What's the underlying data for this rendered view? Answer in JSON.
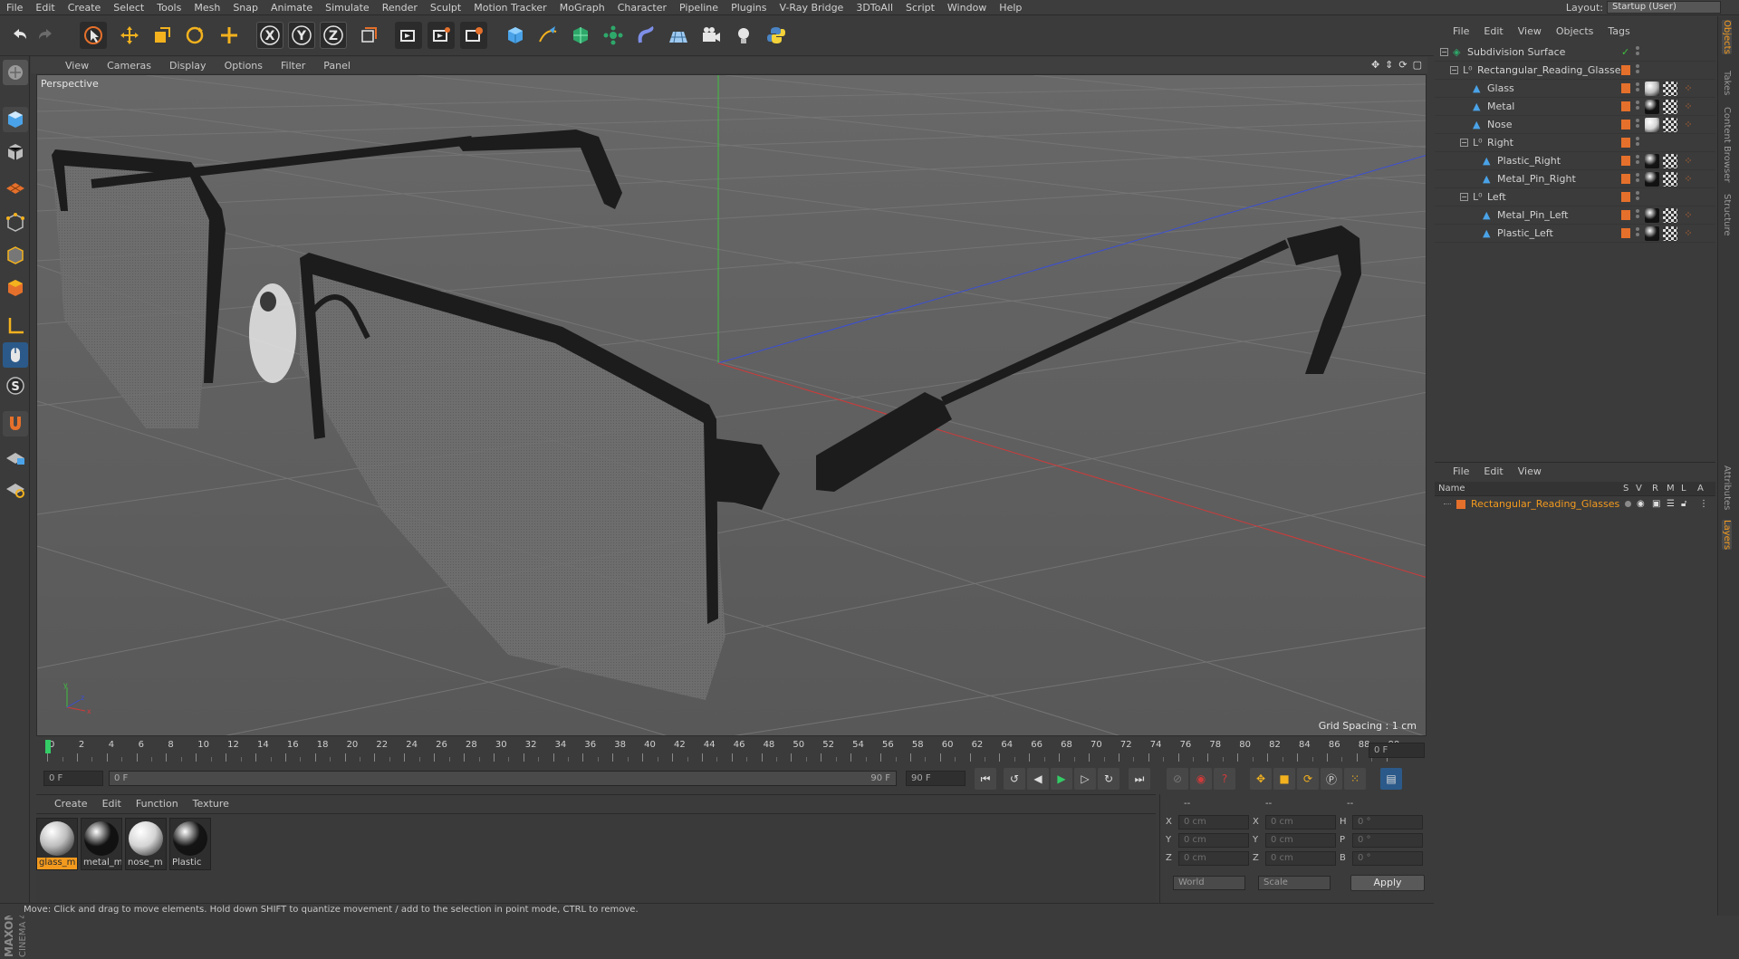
{
  "menubar": {
    "items": [
      "File",
      "Edit",
      "Create",
      "Select",
      "Tools",
      "Mesh",
      "Snap",
      "Animate",
      "Simulate",
      "Render",
      "Sculpt",
      "Motion Tracker",
      "MoGraph",
      "Character",
      "Pipeline",
      "Plugins",
      "V-Ray Bridge",
      "3DToAll",
      "Script",
      "Window",
      "Help"
    ],
    "layout_label": "Layout:",
    "layout_value": "Startup (User)"
  },
  "toolbar": {
    "icons": [
      "undo-icon",
      "redo-icon",
      "live-select-icon",
      "move-icon",
      "scale-icon",
      "rotate-icon",
      "recent-tool-icon",
      "lock-x-icon",
      "lock-y-icon",
      "lock-z-icon",
      "coord-system-icon",
      "render-view-icon",
      "render-picture-viewer-icon",
      "edit-render-settings-icon",
      "cube-icon",
      "pen-spline-icon",
      "subdivision-icon",
      "array-icon",
      "deformer-icon",
      "floor-icon",
      "camera-icon",
      "light-icon",
      "python-icon"
    ],
    "x_label": "X",
    "y_label": "Y",
    "z_label": "Z"
  },
  "viewport": {
    "menu": [
      "View",
      "Cameras",
      "Display",
      "Options",
      "Filter",
      "Panel"
    ],
    "label": "Perspective",
    "grid_spacing": "Grid Spacing : 1 cm",
    "axis_labels": {
      "x": "x",
      "y": "y",
      "z": "z"
    }
  },
  "timeline": {
    "ticks": [
      "0",
      "2",
      "4",
      "6",
      "8",
      "10",
      "12",
      "14",
      "16",
      "18",
      "20",
      "22",
      "24",
      "26",
      "28",
      "30",
      "32",
      "34",
      "36",
      "38",
      "40",
      "42",
      "44",
      "46",
      "48",
      "50",
      "52",
      "54",
      "56",
      "58",
      "60",
      "62",
      "64",
      "66",
      "68",
      "70",
      "72",
      "74",
      "76",
      "78",
      "80",
      "82",
      "84",
      "86",
      "88",
      "90"
    ],
    "current_frame": "0 F",
    "start_field": "0 F",
    "range_start": "0 F",
    "range_end": "90 F",
    "end_field": "90 F"
  },
  "materials": {
    "menu": [
      "Create",
      "Edit",
      "Function",
      "Texture"
    ],
    "items": [
      {
        "label": "glass_m",
        "color": "#bdbdbd",
        "selected": true
      },
      {
        "label": "metal_m",
        "color": "#111111",
        "selected": false
      },
      {
        "label": "nose_m",
        "color": "#d4d4d4",
        "selected": false
      },
      {
        "label": "Plastic",
        "color": "#141414",
        "selected": false
      }
    ]
  },
  "coordinates": {
    "header": [
      "--",
      "--",
      "--"
    ],
    "rows": [
      {
        "a": "X",
        "av": "0 cm",
        "b": "X",
        "bv": "0 cm",
        "c": "H",
        "cv": "0 °"
      },
      {
        "a": "Y",
        "av": "0 cm",
        "b": "Y",
        "bv": "0 cm",
        "c": "P",
        "cv": "0 °"
      },
      {
        "a": "Z",
        "av": "0 cm",
        "b": "Z",
        "bv": "0 cm",
        "c": "B",
        "cv": "0 °"
      }
    ],
    "mode_world": "World",
    "mode_scale": "Scale",
    "apply": "Apply"
  },
  "status": "Move: Click and drag to move elements. Hold down SHIFT to quantize movement / add to the selection in point mode, CTRL to remove.",
  "object_manager": {
    "menu": [
      "File",
      "Edit",
      "View",
      "Objects",
      "Tags"
    ],
    "objects": [
      {
        "name": "Subdivision Surface",
        "indent": 0,
        "icon": "subdivision-icon",
        "tags": []
      },
      {
        "name": "Rectangular_Reading_Glasses",
        "indent": 1,
        "icon": "null-icon",
        "tags": []
      },
      {
        "name": "Glass",
        "indent": 2,
        "icon": "polygon-icon",
        "tags": [
          "#bdbdbd"
        ]
      },
      {
        "name": "Metal",
        "indent": 2,
        "icon": "polygon-icon",
        "tags": [
          "#111111"
        ]
      },
      {
        "name": "Nose",
        "indent": 2,
        "icon": "polygon-icon",
        "tags": [
          "#d4d4d4"
        ]
      },
      {
        "name": "Right",
        "indent": 2,
        "icon": "null-icon",
        "tags": []
      },
      {
        "name": "Plastic_Right",
        "indent": 3,
        "icon": "polygon-icon",
        "tags": [
          "#141414"
        ]
      },
      {
        "name": "Metal_Pin_Right",
        "indent": 3,
        "icon": "polygon-icon",
        "tags": [
          "#111111"
        ]
      },
      {
        "name": "Left",
        "indent": 2,
        "icon": "null-icon",
        "tags": []
      },
      {
        "name": "Metal_Pin_Left",
        "indent": 3,
        "icon": "polygon-icon",
        "tags": [
          "#111111"
        ]
      },
      {
        "name": "Plastic_Left",
        "indent": 3,
        "icon": "polygon-icon",
        "tags": [
          "#141414"
        ]
      }
    ]
  },
  "layer_manager": {
    "menu": [
      "File",
      "Edit",
      "View"
    ],
    "columns": {
      "name": "Name",
      "s": "S",
      "v": "V",
      "r": "R",
      "m": "M",
      "l": "L",
      "a": "A"
    },
    "layers": [
      {
        "name": "Rectangular_Reading_Glasses",
        "color": "#e5702b"
      }
    ]
  },
  "side_tabs": [
    "Objects",
    "Takes",
    "Content Browser",
    "Structure",
    "Attributes",
    "Layers"
  ],
  "brand": {
    "line1": "MAXON",
    "line2": "CINEMA 4D"
  },
  "colors": {
    "accent": "#f39a1e",
    "layer_orange": "#e5702b",
    "viewport_bg": "#5f5f5f"
  }
}
